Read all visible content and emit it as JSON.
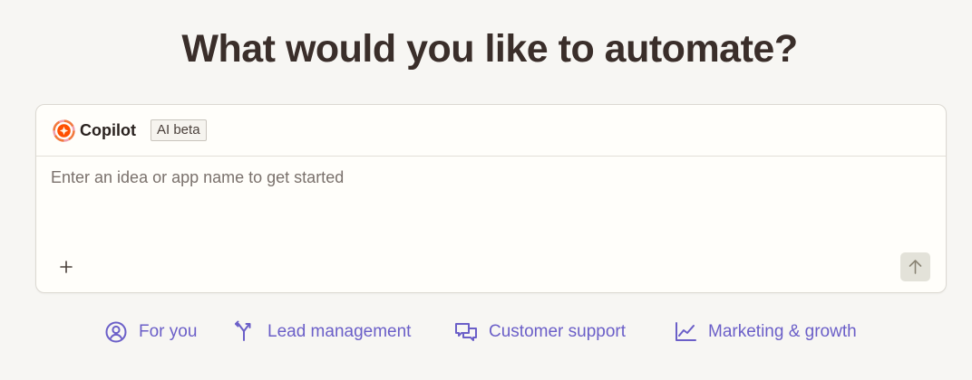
{
  "headline": "What would you like to automate?",
  "copilot": {
    "label": "Copilot",
    "badge": "AI beta",
    "input_placeholder": "Enter an idea or app name to get started",
    "input_value": ""
  },
  "categories": [
    {
      "label": "For you",
      "icon": "user-circle-icon"
    },
    {
      "label": "Lead management",
      "icon": "split-arrows-icon"
    },
    {
      "label": "Customer support",
      "icon": "chat-bubbles-icon"
    },
    {
      "label": "Marketing & growth",
      "icon": "line-chart-icon"
    }
  ],
  "colors": {
    "background": "#f7f6f3",
    "headline": "#3a2e2a",
    "accent": "#6b5fc8",
    "card": "#fffefa"
  }
}
